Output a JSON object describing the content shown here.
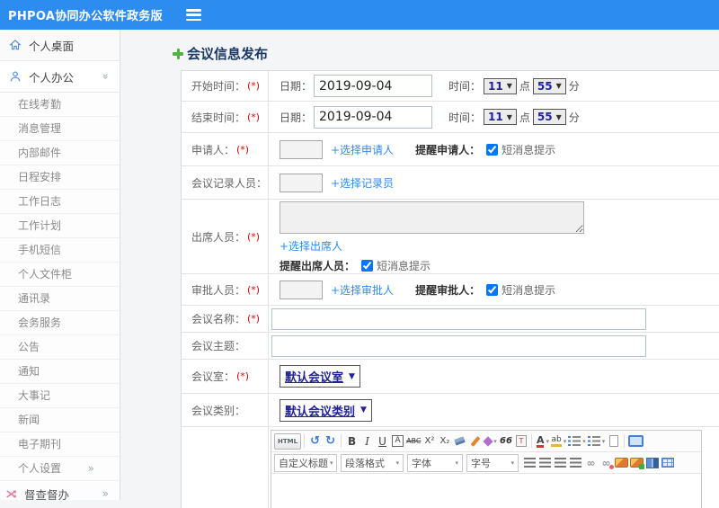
{
  "topbar": {
    "title": "PHPOA协同办公软件政务版"
  },
  "sidebar": {
    "desktop": {
      "label": "个人桌面"
    },
    "office": {
      "label": "个人办公"
    },
    "sub_items": [
      "在线考勤",
      "消息管理",
      "内部邮件",
      "日程安排",
      "工作日志",
      "工作计划",
      "手机短信",
      "个人文件柜",
      "通讯录",
      "会务服务",
      "公告",
      "通知",
      "大事记",
      "新闻",
      "电子期刊"
    ],
    "settings": {
      "label": "个人设置"
    },
    "supervision": {
      "label": "督查督办"
    }
  },
  "glyphs": {
    "chevron_double": "»",
    "select_caret": "▼",
    "mini_caret": "▾"
  },
  "page": {
    "title": "会议信息发布"
  },
  "form": {
    "start_time": {
      "label": "开始时间：",
      "required": "(*)",
      "date_label": "日期：",
      "date_value": "2019-09-04",
      "time_label": "时间：",
      "hour": "11",
      "hour_unit": "点",
      "minute": "55",
      "minute_unit": "分"
    },
    "end_time": {
      "label": "结束时间：",
      "required": "(*)",
      "date_label": "日期：",
      "date_value": "2019-09-04",
      "time_label": "时间：",
      "hour": "11",
      "hour_unit": "点",
      "minute": "55",
      "minute_unit": "分"
    },
    "applicant": {
      "label": "申请人：",
      "required": "(*)",
      "choose_link": "+选择申请人",
      "remind_label": "提醒申请人：",
      "sms_label": "短消息提示"
    },
    "recorder": {
      "label": "会议记录人员：",
      "required": "(*)",
      "choose_link": "+选择记录员"
    },
    "attendees": {
      "label": "出席人员：",
      "required": "(*)",
      "choose_link": "+选择出席人",
      "remind_label": "提醒出席人员：",
      "sms_label": "短消息提示"
    },
    "approver": {
      "label": "审批人员：",
      "required": "(*)",
      "choose_link": "+选择审批人",
      "remind_label": "提醒审批人：",
      "sms_label": "短消息提示"
    },
    "meeting_name": {
      "label": "会议名称：",
      "required": "(*)"
    },
    "meeting_topic": {
      "label": "会议主题："
    },
    "meeting_room": {
      "label": "会议室：",
      "required": "(*)",
      "value": "默认会议室"
    },
    "meeting_category": {
      "label": "会议类别：",
      "value": "默认会议类别"
    }
  },
  "editor": {
    "icons": {
      "html": "HTML",
      "undo": "↺",
      "redo": "↻",
      "bold": "B",
      "italic": "I",
      "underline": "U",
      "box_a": "A",
      "strike": "ABC",
      "sup": "X²",
      "sub": "X₂",
      "quote": "66",
      "paste_t": "T",
      "font_color": "A",
      "highlight": "ab",
      "link": "∞",
      "unlink": "∞"
    },
    "selects": [
      {
        "label": "自定义标题"
      },
      {
        "label": "段落格式"
      },
      {
        "label": "字体"
      },
      {
        "label": "字号"
      }
    ]
  },
  "colors": {
    "topbar_blue": "#2d8cf0",
    "link_blue": "#2d8cf0",
    "select_navy": "#22229a",
    "required_red": "#e60000",
    "accent_green": "#53b046"
  }
}
